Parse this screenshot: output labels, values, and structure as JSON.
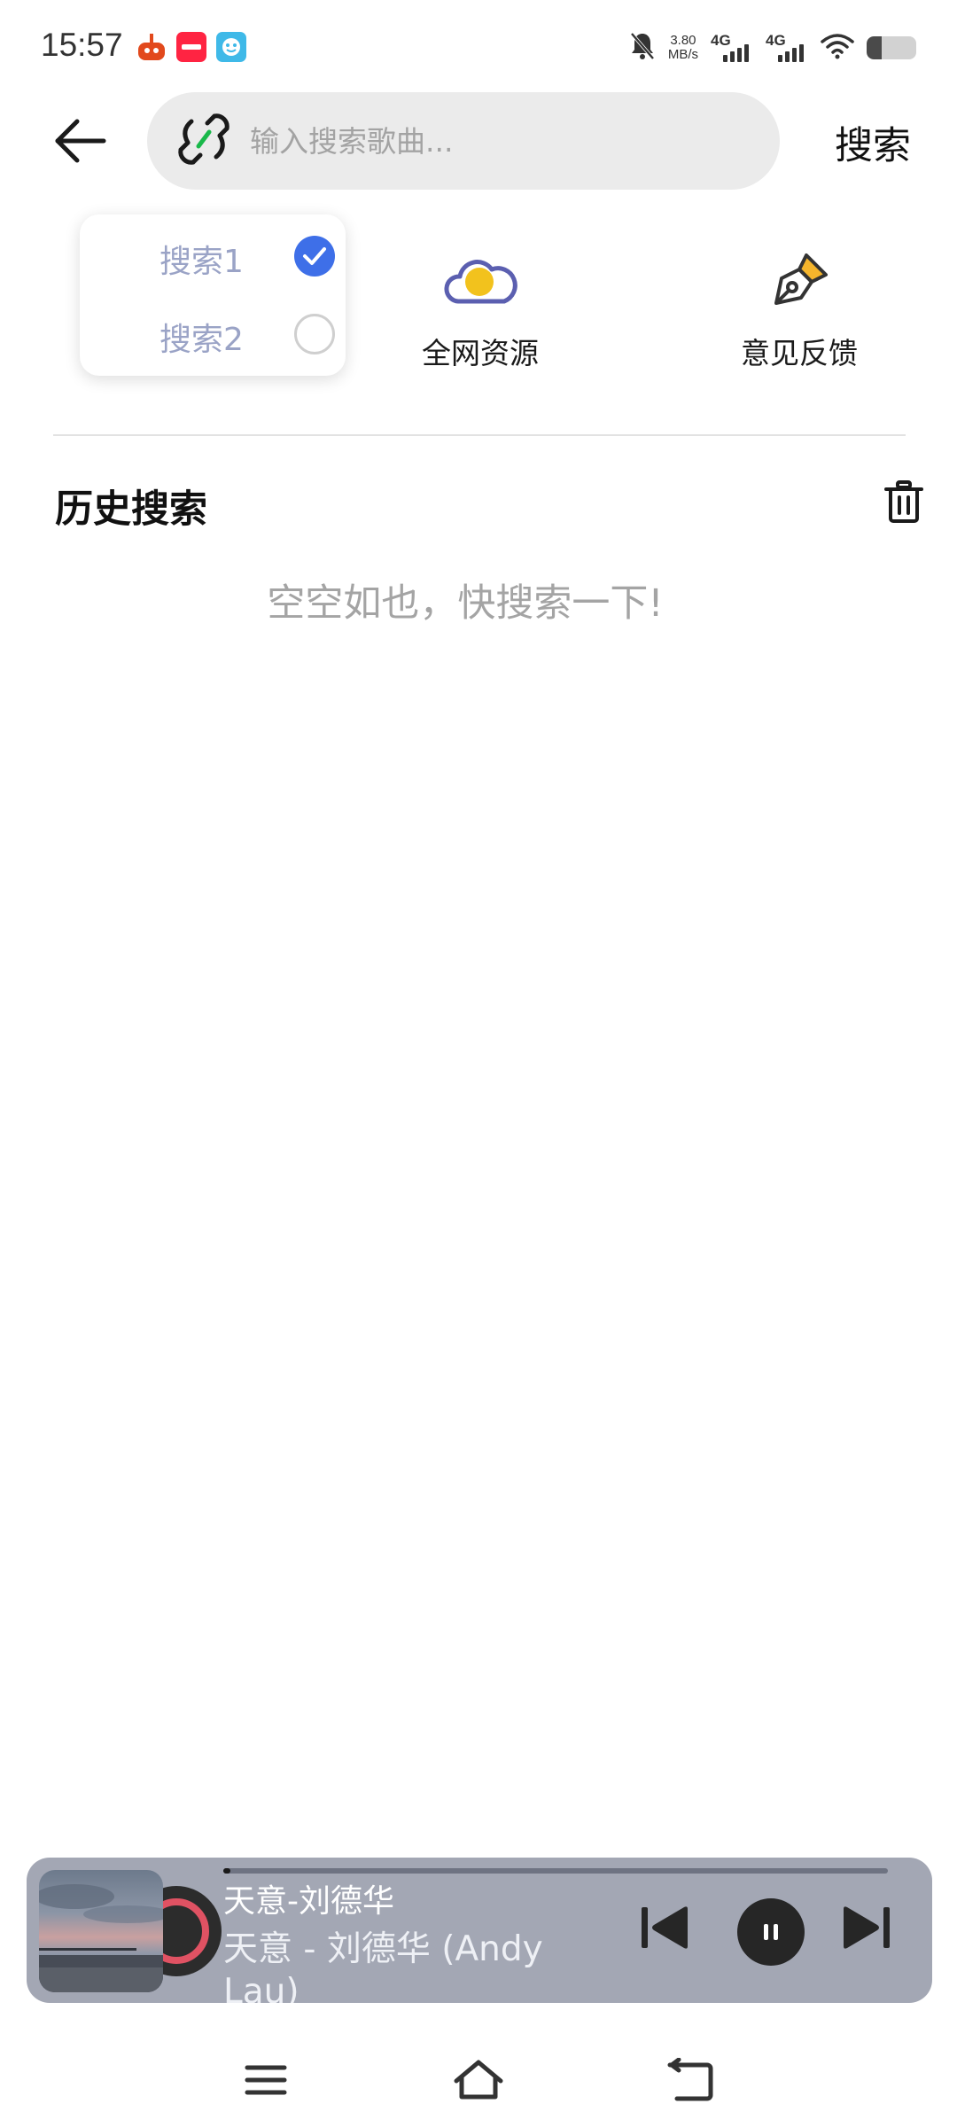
{
  "status_bar": {
    "time": "15:57",
    "network_speed_value": "3.80",
    "network_speed_unit": "MB/s",
    "sim1_label": "4G",
    "sim2_label": "4G",
    "battery_level": 0.3,
    "notification_icons": [
      "app-icon-food",
      "app-icon-xiaohongshu",
      "app-icon-assistant"
    ]
  },
  "header": {
    "search_placeholder": "输入搜索歌曲...",
    "search_button_label": "搜索"
  },
  "source_popup": {
    "options": [
      {
        "label": "搜索1",
        "selected": true
      },
      {
        "label": "搜索2",
        "selected": false
      }
    ]
  },
  "quick_actions": [
    {
      "label": "全网资源",
      "icon": "cloud-sun-icon"
    },
    {
      "label": "意见反馈",
      "icon": "pen-nib-icon"
    }
  ],
  "history": {
    "title": "历史搜索",
    "empty_text": "空空如也，快搜索一下!"
  },
  "player": {
    "title": "天意-刘德华",
    "subtitle": "天意 - 刘德华 (Andy Lau)",
    "progress": 0.01
  },
  "colors": {
    "accent": "#3E6FE8",
    "player_background": "#A3A7B4",
    "search_background": "#EBEBEB",
    "muted_text": "#A4A4A4",
    "option_text": "#9AA3C6"
  }
}
